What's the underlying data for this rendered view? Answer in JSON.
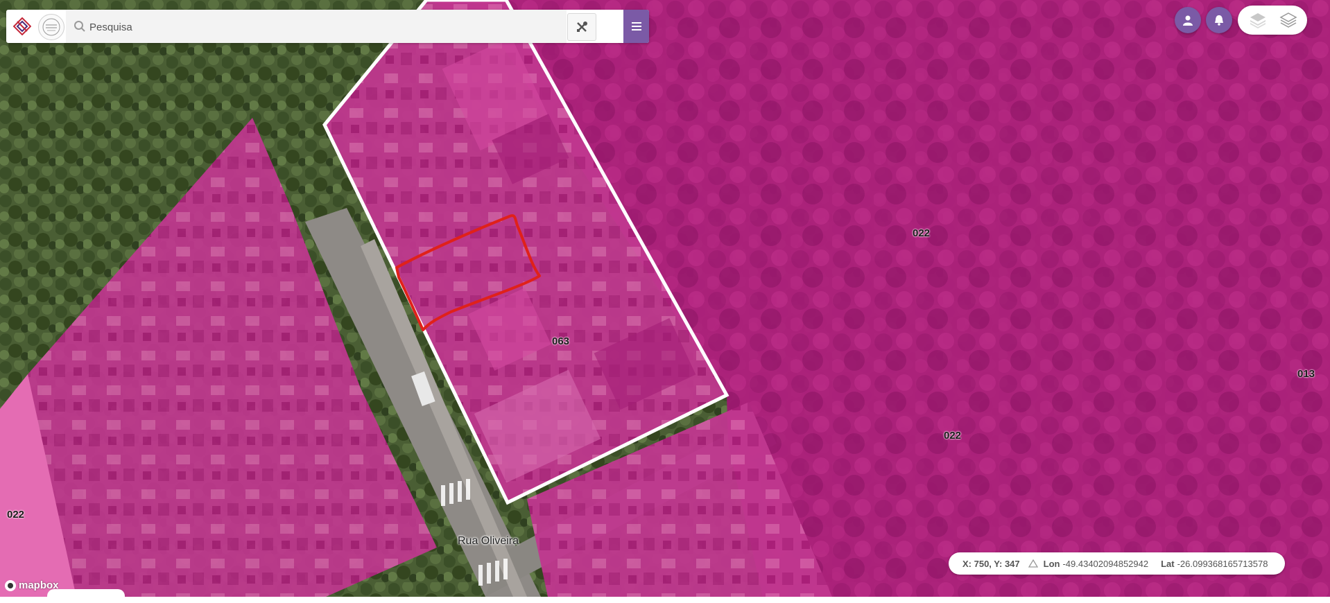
{
  "search": {
    "placeholder": "Pesquisa"
  },
  "icons": {
    "search": "search-icon",
    "tools": "tools-icon",
    "menu": "hamburger-menu-icon",
    "user": "user-icon",
    "bell": "bell-icon",
    "layers_1": "layers-icon",
    "layers_2": "layers-icon",
    "coord_sep": "triangle-icon"
  },
  "colors": {
    "accent": "#7b5aa6",
    "parcel_fill": "#c2188a",
    "selected_outline": "#ffffff",
    "drawn_outline": "#e0211a"
  },
  "map": {
    "parcel_labels": [
      "063",
      "022",
      "022",
      "022",
      "013"
    ],
    "street_name": "Rua Oliveira",
    "attribution": "mapbox"
  },
  "coordinates": {
    "xy": "X: 750, Y: 347",
    "lon_label": "Lon",
    "lon_value": "-49.43402094852942",
    "lat_label": "Lat",
    "lat_value": "-26.099368165713578"
  }
}
